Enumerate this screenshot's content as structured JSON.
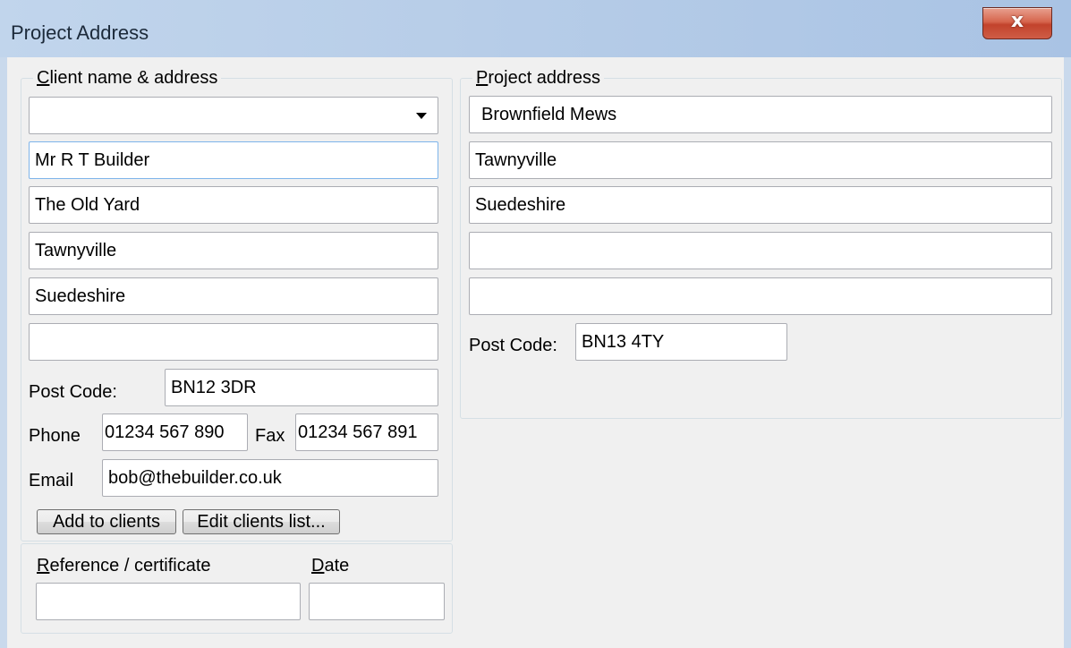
{
  "window": {
    "title": "Project Address",
    "close_symbol": "x"
  },
  "client_group": {
    "legend_accel": "C",
    "legend_rest": "lient name & address",
    "combo_value": "",
    "lines": [
      "Mr R T Builder",
      "The Old Yard",
      "Tawnyville",
      "Suedeshire",
      ""
    ],
    "post_code_label": "Post Code:",
    "post_code": "BN12 3DR",
    "phone_label": "Phone",
    "phone": "01234 567 890",
    "fax_label": "Fax",
    "fax": "01234 567 891",
    "email_label": "Email",
    "email": "bob@thebuilder.co.uk",
    "add_button": "Add to clients",
    "edit_button": "Edit clients list..."
  },
  "reference_group": {
    "reference_accel": "R",
    "reference_rest": "eference / certificate",
    "reference_value": "",
    "date_accel": "D",
    "date_rest": "ate",
    "date_value": ""
  },
  "project_group": {
    "legend_accel": "P",
    "legend_rest": "roject address",
    "lines": [
      "Brownfield Mews",
      "Tawnyville",
      "Suedeshire",
      "",
      ""
    ],
    "post_code_label": "Post Code:",
    "post_code": "BN13 4TY"
  }
}
